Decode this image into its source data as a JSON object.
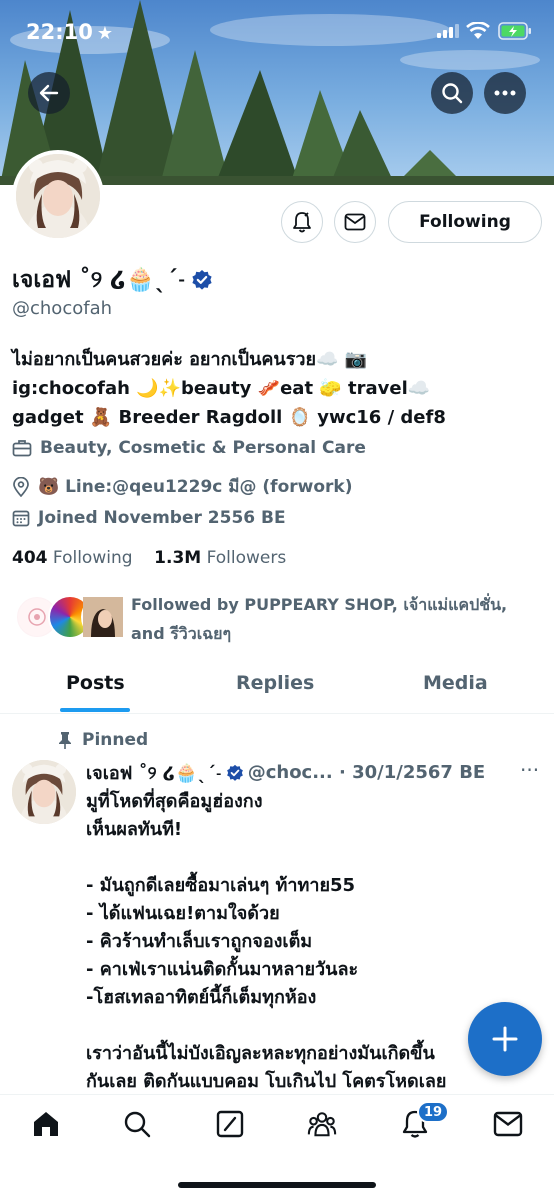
{
  "status_bar": {
    "time": "22:10",
    "star": "★"
  },
  "header": {
    "back_icon": "back-arrow-icon",
    "search_icon": "search-icon",
    "more_icon": "more-icon"
  },
  "profile": {
    "display_name": "เจเอฟ ˚୨ ໒🧁ˎˊ˗",
    "handle": "@chocofah",
    "following_button": "Following",
    "bio_lines": [
      "ไม่อยากเป็นคนสวยค่ะ อยากเป็นคนรวย☁️ 📷",
      "ig:chocofah 🌙✨beauty 🥓eat 🧽 travel☁️",
      "gadget 🧸 Breeder Ragdoll 🪞 ywc16 / def8"
    ],
    "category": "Beauty, Cosmetic & Personal Care",
    "location": "🐻 Line:@qeu1229c มี@ (forwork)",
    "joined": "Joined November 2556 BE",
    "following_count": "404",
    "following_label": "Following",
    "followers_count": "1.3M",
    "followers_label": "Followers",
    "followed_by_line1": "Followed by PUPPEARY SHOP, เจ้าแม่แคปชั่น,",
    "followed_by_line2": "and รีวิวเฉยๆ"
  },
  "tabs": [
    "Posts",
    "Replies",
    "Media"
  ],
  "pinned_label": "Pinned",
  "tweet": {
    "name": "เจเอฟ ˚୨ ໒🧁ˎˊ˗",
    "meta": "@choc... · 30/1/2567 BE",
    "more": "···",
    "body": "มูที่โหดที่สุดคือมูฮ่องกง\nเห็นผลทันที!\n\n- มันถูกดีเลยซื้อมาเล่นๆ ท้าทาย55\n- ได้แฟนเฉย!ตามใจด้วย\n- คิวร้านทำเล็บเราถูกจองเต็ม\n- คาเฟ่เราแน่นติดกั้นมาหลายวันละ\n-โฮสเทลอาทิตย์นี้ก็เต็มทุกห้อง\n\nเราว่าอันนี้ไม่บังเอิญละหละทุกอย่างมันเกิดขึ้น\nกันเลย ติดกันแบบคอม โบเกินไป โคตรโหดเลย"
  },
  "fab_icon": "plus-icon",
  "nav": {
    "notification_count": "19"
  },
  "colors": {
    "accent": "#1d9bf0",
    "fab": "#1d6fc8",
    "verified": "#1d4ea8"
  }
}
